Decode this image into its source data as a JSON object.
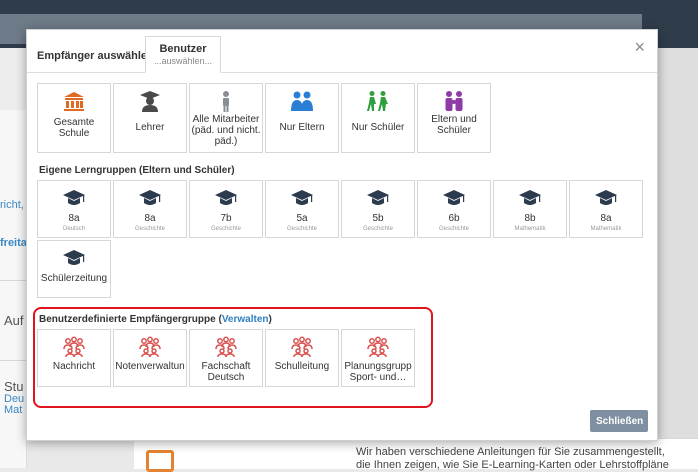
{
  "background": {
    "fragments": [
      "richt,",
      "freita",
      "Auf",
      "Stu",
      "Deu",
      "Mat"
    ],
    "bottom_lines": [
      "Wir haben verschiedene Anleitungen für Sie zusammengestellt,",
      "die Ihnen zeigen, wie Sie E-Learning-Karten oder Lehrstoffpläne"
    ]
  },
  "modal": {
    "tab_recipients": "Empfänger auswählen",
    "tab_users_title": "Benutzer",
    "tab_users_sub": "...auswählen...",
    "close_icon": "×",
    "groups": [
      {
        "label": "Gesamte\nSchule",
        "icon": "school-building-icon"
      },
      {
        "label": "Lehrer",
        "icon": "teacher-icon"
      },
      {
        "label": "Alle Mitarbeiter (päd. und nicht. päd.)",
        "icon": "staff-person-icon"
      },
      {
        "label": "Nur Eltern",
        "icon": "parents-icon"
      },
      {
        "label": "Nur Schüler",
        "icon": "students-icon"
      },
      {
        "label": "Eltern und Schüler",
        "icon": "parents-and-students-icon"
      }
    ],
    "learning_groups_title": "Eigene Lerngruppen (Eltern und Schüler)",
    "learning_groups": [
      {
        "name": "8a",
        "subject": "Deutsch"
      },
      {
        "name": "8a",
        "subject": "Geschichte"
      },
      {
        "name": "7b",
        "subject": "Geschichte"
      },
      {
        "name": "5a",
        "subject": "Geschichte"
      },
      {
        "name": "5b",
        "subject": "Geschichte"
      },
      {
        "name": "6b",
        "subject": "Geschichte"
      },
      {
        "name": "8b",
        "subject": "Mathematik"
      },
      {
        "name": "8a",
        "subject": "Mathematik"
      },
      {
        "name": "Schülerzeitung",
        "subject": ""
      }
    ],
    "custom_groups_title": "Benutzerdefinierte Empfängergruppe (",
    "custom_groups_link": "Verwalten",
    "custom_groups_title_end": ")",
    "custom_groups": [
      "Nachricht",
      "Notenverwaltun",
      "Fachschaft Deutsch",
      "Schulleitung",
      "Planungsgrupp Sport- und…"
    ],
    "close_button": "Schließen"
  },
  "colors": {
    "school_orange": "#e06a21",
    "teacher_dark": "#4a4a4a",
    "staff_gray": "#8a8f96",
    "parents_blue": "#2a7fd4",
    "students_green": "#2e9e3e",
    "purple": "#8e3aa8",
    "graduation_navy": "#2c3b4d",
    "group_red": "#d9534f",
    "highlight_red": "#e0141e",
    "link_blue": "#2f7fc1"
  }
}
